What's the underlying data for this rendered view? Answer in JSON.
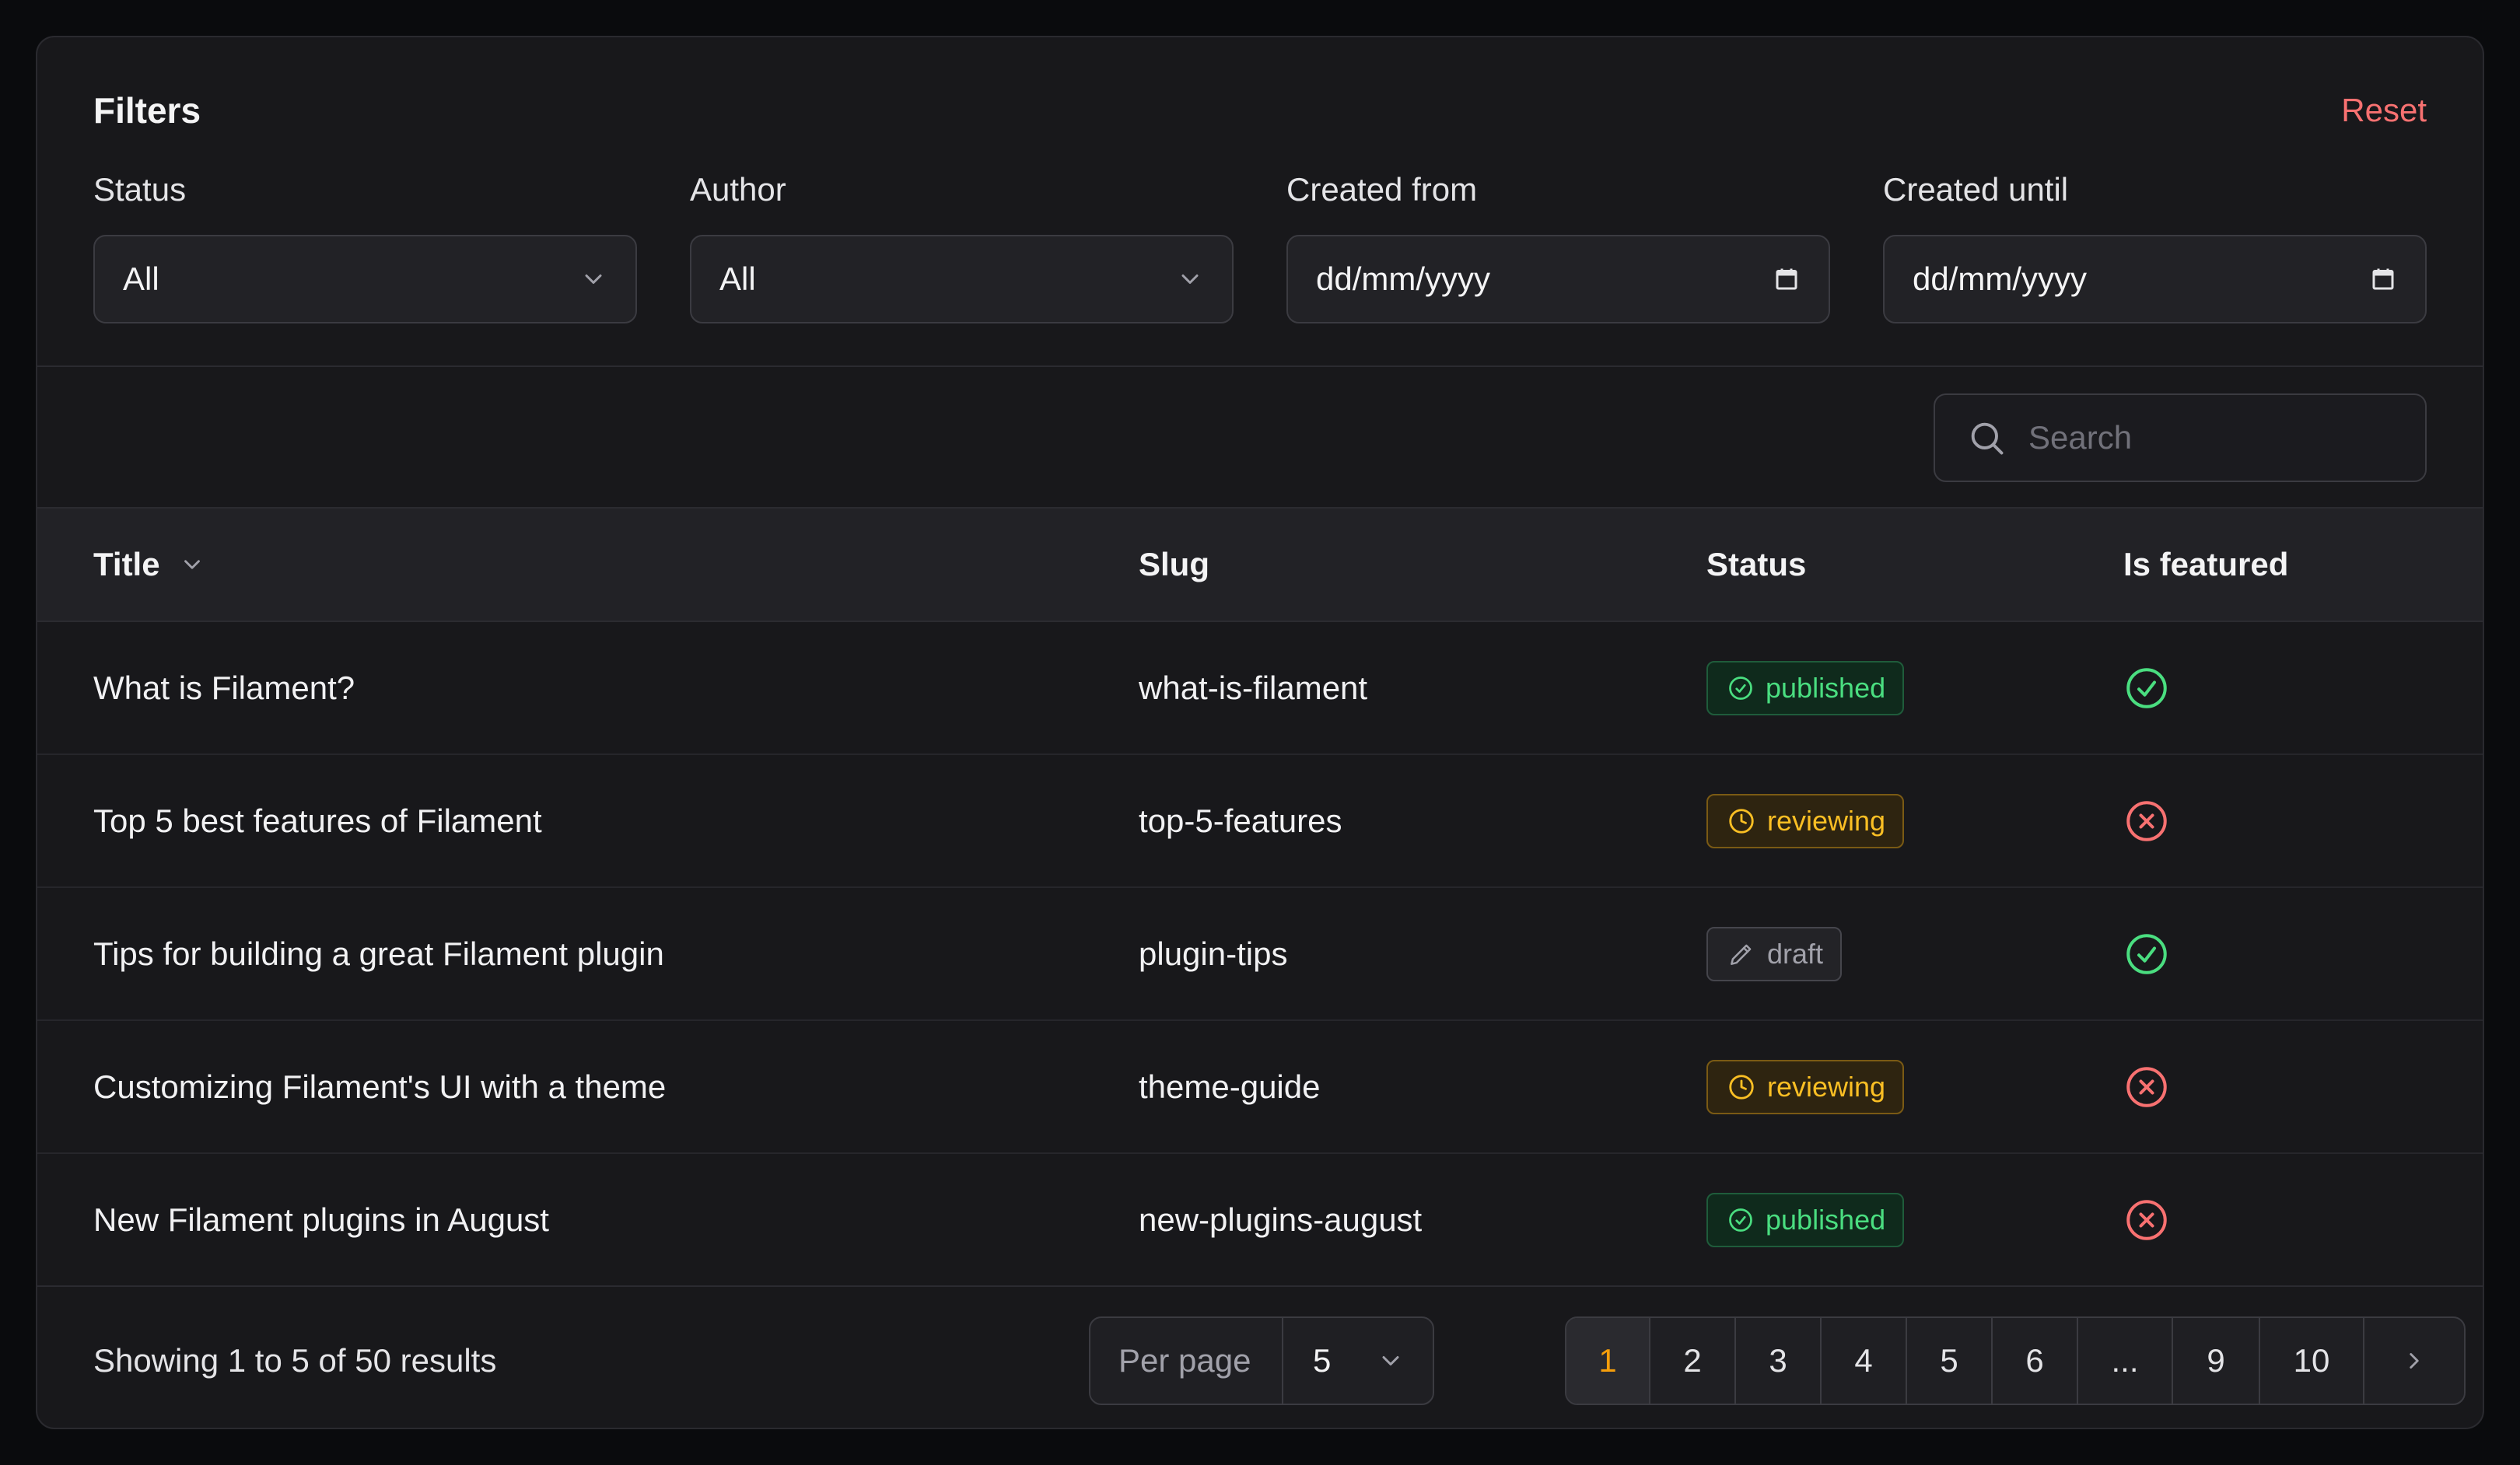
{
  "filters": {
    "title": "Filters",
    "reset_label": "Reset",
    "fields": [
      {
        "label": "Status",
        "value": "All",
        "kind": "select"
      },
      {
        "label": "Author",
        "value": "All",
        "kind": "select"
      },
      {
        "label": "Created from",
        "value": "dd/mm/yyyy",
        "kind": "date"
      },
      {
        "label": "Created until",
        "value": "dd/mm/yyyy",
        "kind": "date"
      }
    ]
  },
  "search": {
    "placeholder": "Search"
  },
  "table": {
    "headers": {
      "title": "Title",
      "slug": "Slug",
      "status": "Status",
      "featured": "Is featured"
    },
    "rows": [
      {
        "title": "What is Filament?",
        "slug": "what-is-filament",
        "status": "published",
        "featured": true
      },
      {
        "title": "Top 5 best features of Filament",
        "slug": "top-5-features",
        "status": "reviewing",
        "featured": false
      },
      {
        "title": "Tips for building a great Filament plugin",
        "slug": "plugin-tips",
        "status": "draft",
        "featured": true
      },
      {
        "title": "Customizing Filament's UI with a theme",
        "slug": "theme-guide",
        "status": "reviewing",
        "featured": false
      },
      {
        "title": "New Filament plugins in August",
        "slug": "new-plugins-august",
        "status": "published",
        "featured": false
      }
    ]
  },
  "footer": {
    "showing": "Showing 1 to 5 of 50 results",
    "per_page_label": "Per page",
    "per_page_value": "5",
    "pages": [
      "1",
      "2",
      "3",
      "4",
      "5",
      "6",
      "...",
      "9",
      "10"
    ],
    "active_page": "1"
  },
  "colors": {
    "background": "#0a0b0d",
    "card": "#18181b",
    "danger": "#f87171",
    "success": "#4ade80",
    "warning": "#fbbf24",
    "accent": "#f59e0b"
  }
}
